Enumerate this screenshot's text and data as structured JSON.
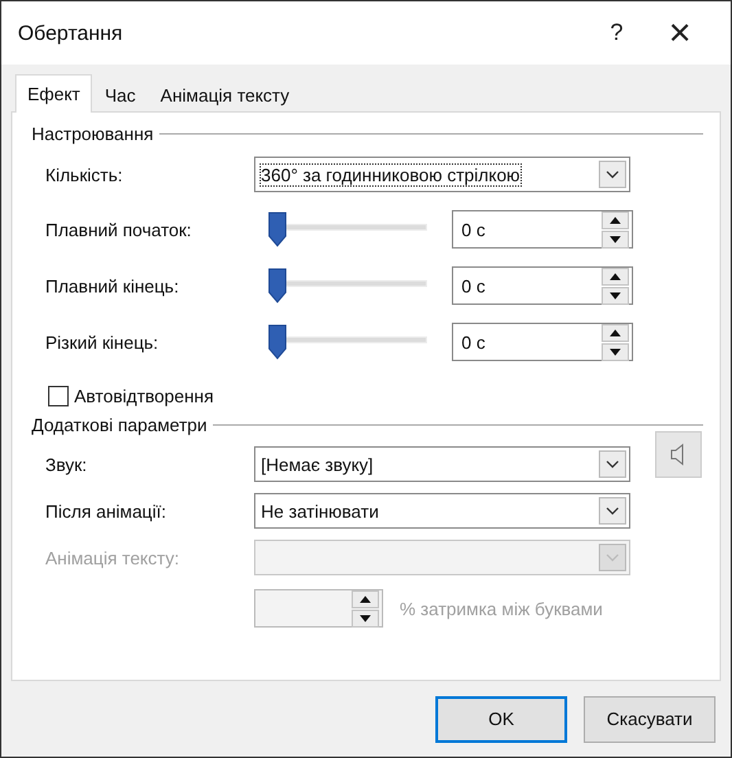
{
  "window": {
    "title": "Обертання",
    "help": "?",
    "close": "×"
  },
  "tabs": [
    {
      "label": "Ефект",
      "selected": true
    },
    {
      "label": "Час",
      "selected": false
    },
    {
      "label": "Анімація тексту",
      "selected": false
    }
  ],
  "settings": {
    "heading": "Настроювання",
    "amount": {
      "label": "Кількість:",
      "value": "360° за годинниковою стрілкою"
    },
    "sliders": [
      {
        "label": "Плавний початок:",
        "level": 0,
        "value": "0 с"
      },
      {
        "label": "Плавний кінець:",
        "level": 0,
        "value": "0 с"
      },
      {
        "label": "Різкий кінець:",
        "level": 0,
        "value": "0 с"
      }
    ],
    "autoreverse": {
      "label": "Автовідтворення",
      "checked": false
    }
  },
  "extra": {
    "heading": "Додаткові параметри",
    "rows": [
      {
        "label": "Звук:",
        "value": "[Немає звуку]",
        "disabled": false,
        "sound_button": true
      },
      {
        "label": "Після анімації:",
        "value": "Не затінювати",
        "disabled": false,
        "sound_button": false
      },
      {
        "label": "Анімація тексту:",
        "value": "",
        "disabled": true,
        "sound_button": false
      }
    ],
    "delay": {
      "label": "% затримка між буквами",
      "disabled": true
    }
  },
  "buttons": [
    {
      "label": "OK",
      "default": true
    },
    {
      "label": "Скасувати",
      "default": false
    }
  ]
}
